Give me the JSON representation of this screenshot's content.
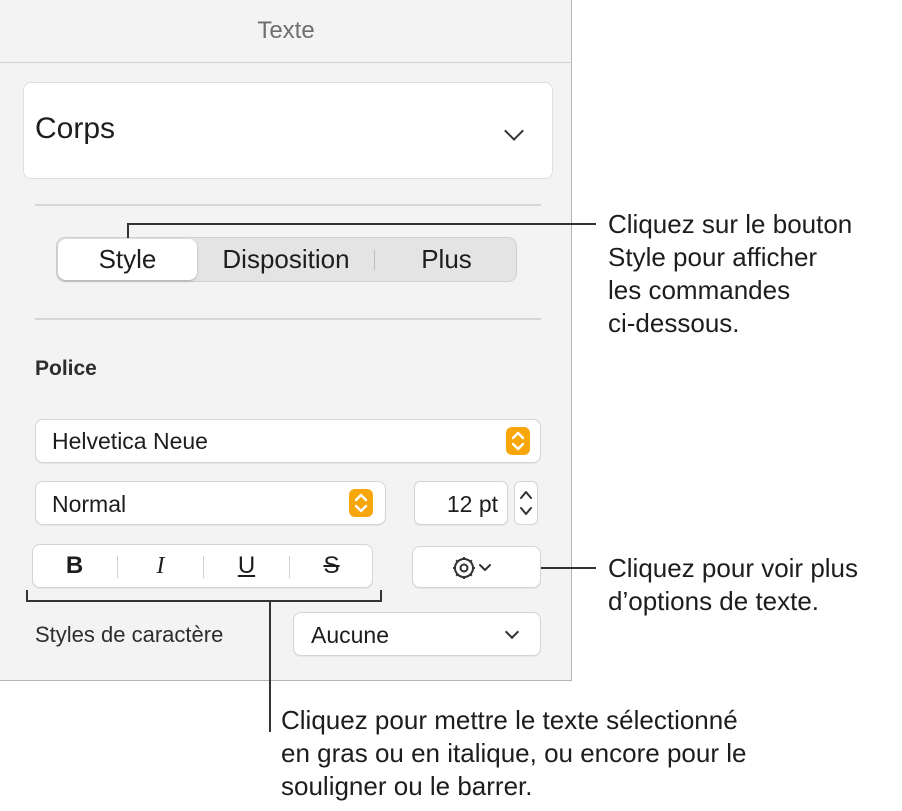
{
  "panel": {
    "title": "Texte",
    "paragraph_style": "Corps",
    "tabs": [
      {
        "label": "Style",
        "active": true
      },
      {
        "label": "Disposition",
        "active": false
      },
      {
        "label": "Plus",
        "active": false
      }
    ],
    "font_section": "Police",
    "font_family": "Helvetica Neue",
    "font_weight": "Normal",
    "font_size": "12 pt",
    "format_buttons": [
      "B",
      "I",
      "U",
      "S"
    ],
    "char_styles_label": "Styles de caractère",
    "char_styles_value": "Aucune",
    "accent_color": "#f7a60c"
  },
  "callouts": {
    "style_button": [
      "Cliquez sur le bouton",
      "Style pour afficher",
      "les commandes",
      "ci-dessous."
    ],
    "more_options": [
      "Cliquez pour voir plus",
      "d’options de texte."
    ],
    "format": [
      "Cliquez pour mettre le texte sélectionné",
      "en gras ou en italique, ou encore pour le",
      "souligner ou le barrer."
    ]
  }
}
